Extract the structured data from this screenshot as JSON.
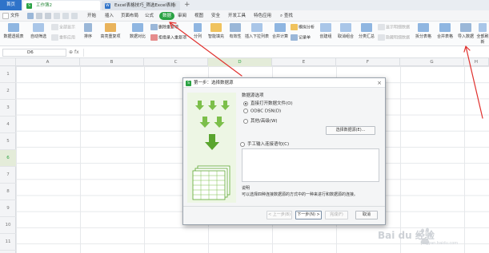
{
  "tabs": {
    "home_label": "首页",
    "sheet_tab": "工作簿2",
    "web_tab": "Excel表格技巧_筛选Excel表格",
    "new_tab": "+"
  },
  "menu": {
    "file": "文件",
    "items": [
      "开始",
      "插入",
      "页面布局",
      "公式",
      "数据",
      "审阅",
      "视图",
      "安全",
      "开发工具",
      "特色应用"
    ],
    "active": "数据",
    "search": "查找"
  },
  "ribbon": {
    "pivot": "数据透视表",
    "autofilter": "自动筛选",
    "show_all": "全部显示",
    "reapply": "重新应用",
    "sort": "排序",
    "highlight_dup": "高亮重复项",
    "data_compare": "数据对比",
    "reject_dup": "拒绝录入重复项",
    "delete_dup": "删除重复项",
    "split": "分列",
    "fill": "智能填充",
    "validity": "有效性",
    "insert_dropdown": "插入下拉列表",
    "consolidate": "合并计算",
    "simulate": "模拟分析",
    "record": "记录单",
    "group": "创建组",
    "ungroup": "取消组合",
    "subtotal": "分类汇总",
    "show_detail": "显示明细数据",
    "hide_detail": "隐藏明细数据",
    "split_sheet": "拆分表格",
    "merge_sheet": "合并表格",
    "import_data": "导入数据",
    "all_refresh": "全部刷新"
  },
  "formula_bar": {
    "cell_ref": "D6",
    "fx": "fx"
  },
  "grid": {
    "columns": [
      "A",
      "B",
      "C",
      "D",
      "E",
      "F",
      "G",
      "H"
    ],
    "selected_column": "D",
    "rows": [
      "1",
      "2",
      "3",
      "4",
      "5",
      "6",
      "7",
      "8",
      "9",
      "10",
      "11"
    ],
    "selected_row": "6"
  },
  "dialog": {
    "title": "第一步：选择数据源",
    "section_label": "数据源选项",
    "options": [
      "直接打开数据文件(O)",
      "ODBC DSN(D)",
      "其他/高级(W)"
    ],
    "selected_option": "直接打开数据文件(O)",
    "choose_button": "选择数据源(E)...",
    "manual_option": "手工输入连接语句(C)",
    "note_title": "说明",
    "note_text": "可以选择四种连接数据源的方式中的一种来进行和数据源的连接。",
    "prev_button": "< 上一步(B)",
    "next_button": "下一步(N) >",
    "finish_button": "完成(F)",
    "cancel_button": "取消"
  },
  "watermark": {
    "text": "Bai du 经验",
    "sub": "jingyan.baidu.com"
  },
  "colors": {
    "accent_green": "#2aa243",
    "tab_blue": "#2f73c9",
    "annotation_red": "#e0302d"
  }
}
